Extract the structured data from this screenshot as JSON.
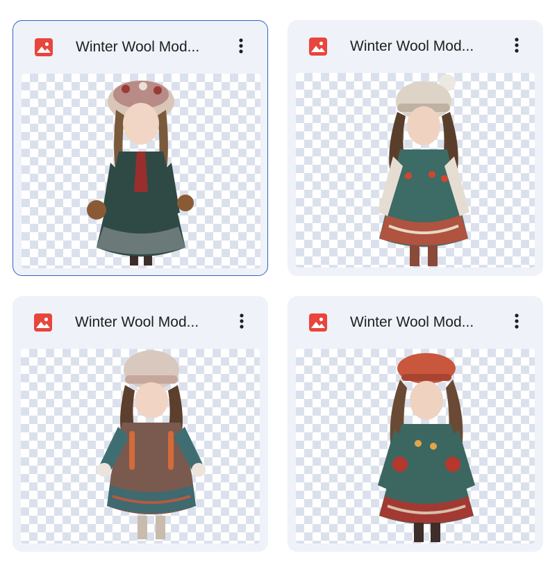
{
  "files": [
    {
      "title": "Winter Wool Mod...",
      "selected": true,
      "kind": "image-file-icon"
    },
    {
      "title": "Winter Wool Mod...",
      "selected": false,
      "kind": "image-file-icon"
    },
    {
      "title": "Winter Wool Mod...",
      "selected": false,
      "kind": "image-file-icon"
    },
    {
      "title": "Winter Wool Mod...",
      "selected": false,
      "kind": "image-file-icon"
    }
  ],
  "icons": {
    "file_type": "image-file-icon",
    "menu": "more-vert-icon"
  },
  "colors": {
    "card_background": "#eff2f8",
    "selected_border": "#2f62c8",
    "image_icon_red": "#e8453c",
    "checker_light": "#ffffff",
    "checker_dark": "#dbe1ec"
  }
}
